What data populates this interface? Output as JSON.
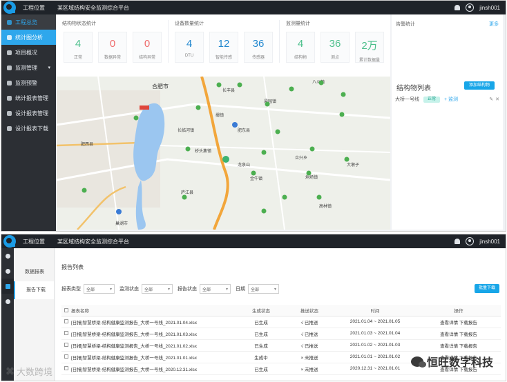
{
  "header": {
    "system": "工程位置",
    "project": "某区域结构安全监测综合平台",
    "user": "jinsh001"
  },
  "sidebar": {
    "items": [
      {
        "label": "工程总览",
        "state": "active"
      },
      {
        "label": "统计图分析",
        "state": "selected"
      },
      {
        "label": "项目概况",
        "state": ""
      },
      {
        "label": "监测管理",
        "state": "",
        "caret": "▾"
      },
      {
        "label": "监测预警",
        "state": ""
      },
      {
        "label": "统计报表管理",
        "state": ""
      },
      {
        "label": "设计报表管理",
        "state": ""
      },
      {
        "label": "设计报表下载",
        "state": ""
      }
    ]
  },
  "stats": {
    "groups": [
      {
        "title": "结构物状态统计",
        "cards": [
          {
            "value": "4",
            "label": "正常",
            "color": "green"
          },
          {
            "value": "0",
            "label": "数据异常",
            "color": "red"
          },
          {
            "value": "0",
            "label": "结构异常",
            "color": "red"
          }
        ]
      },
      {
        "title": "设备数量统计",
        "cards": [
          {
            "value": "4",
            "label": "DTU",
            "color": "blue"
          },
          {
            "value": "12",
            "label": "智能传感",
            "color": "blue"
          },
          {
            "value": "36",
            "label": "传感器",
            "color": "blue"
          }
        ]
      },
      {
        "title": "监测量统计",
        "cards": [
          {
            "value": "4",
            "label": "结构物",
            "color": "green"
          },
          {
            "value": "36",
            "label": "测点",
            "color": "green"
          },
          {
            "value": "2万",
            "label": "累计数据量",
            "color": "green"
          }
        ]
      }
    ],
    "warnings": {
      "title": "告警统计",
      "more": "更多"
    }
  },
  "map": {
    "places": [
      "合肥市",
      "长丰县",
      "肥东县",
      "肥西县",
      "巢湖市",
      "撮镇",
      "梁园镇",
      "八斗镇",
      "众兴乡",
      "桥头集镇",
      "烔炀镇",
      "长临河镇",
      "庐江县",
      "金牛镇",
      "高林镇",
      "大墩子",
      "龙泉山"
    ]
  },
  "structure_list": {
    "title": "结构物列表",
    "add_button": "添加结构物",
    "item": {
      "name": "大桥一号线",
      "tag": "正常",
      "op": "+ 监测"
    }
  },
  "page2": {
    "submenu": [
      {
        "label": "数据报表",
        "selected": false
      },
      {
        "label": "报告下载",
        "selected": true
      }
    ],
    "title": "报告列表",
    "filters": [
      {
        "label": "报表类型",
        "value": "全部"
      },
      {
        "label": "监测状态",
        "value": "全部"
      },
      {
        "label": "报告状态",
        "value": "全部"
      },
      {
        "label": "日期",
        "value": "全部"
      }
    ],
    "download_button": "批量下载",
    "columns": [
      "报表名称",
      "生成状态",
      "推送状态",
      "时间",
      "操作"
    ],
    "rows": [
      {
        "name": "[日报]智慧桥梁-结构健康监测报告_大桥一号线_2021.01.04.xlsx",
        "gen": "已生成",
        "push": "√ 已推送",
        "push_ok": true,
        "time": "2021.01.04 ~ 2021.01.05",
        "op": "查看详情 下载报告"
      },
      {
        "name": "[日报]智慧桥梁-结构健康监测报告_大桥一号线_2021.01.03.xlsx",
        "gen": "已生成",
        "push": "√ 已推送",
        "push_ok": true,
        "time": "2021.01.03 ~ 2021.01.04",
        "op": "查看详情 下载报告"
      },
      {
        "name": "[日报]智慧桥梁-结构健康监测报告_大桥一号线_2021.01.02.xlsx",
        "gen": "已生成",
        "push": "√ 已推送",
        "push_ok": true,
        "time": "2021.01.02 ~ 2021.01.03",
        "op": "查看详情 下载报告"
      },
      {
        "name": "[日报]智慧桥梁-结构健康监测报告_大桥一号线_2021.01.01.xlsx",
        "gen": "生成中",
        "push": "× 未推送",
        "push_ok": false,
        "time": "2021.01.01 ~ 2021.01.02",
        "op": "查看详情 下载报告"
      },
      {
        "name": "[日报]智慧桥梁-结构健康监测报告_大桥一号线_2020.12.31.xlsx",
        "gen": "已生成",
        "push": "× 未推送",
        "push_ok": false,
        "time": "2020.12.31 ~ 2021.01.01",
        "op": "查看详情 下载报告"
      }
    ]
  },
  "watermarks": {
    "left": "大数跨境",
    "right": "恒旺数字科技"
  }
}
